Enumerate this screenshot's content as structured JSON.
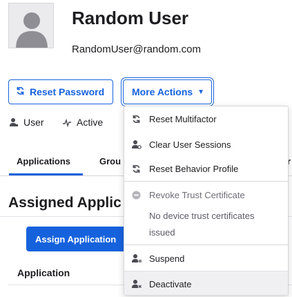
{
  "user": {
    "name": "Random User",
    "email": "RandomUser@random.com"
  },
  "actions": {
    "reset_password": "Reset Password",
    "more_actions": "More Actions"
  },
  "meta": {
    "type_label": "User",
    "status_label": "Active"
  },
  "tabs": [
    {
      "label": "Applications",
      "active": true
    },
    {
      "label": "Grou",
      "active": false
    },
    {
      "label": "r",
      "active": false
    }
  ],
  "section": {
    "title": "Assigned Applic",
    "assign_button": "Assign Application",
    "table_headers": [
      "Application"
    ]
  },
  "more_actions_menu": {
    "items": [
      {
        "label": "Reset Multifactor",
        "icon": "refresh-icon",
        "enabled": true
      },
      {
        "label": "Clear User Sessions",
        "icon": "user-clear-icon",
        "enabled": true
      },
      {
        "label": "Reset Behavior Profile",
        "icon": "refresh-icon",
        "enabled": true
      },
      {
        "label": "Revoke Trust Certificate",
        "icon": "minus-circle-icon",
        "enabled": false
      },
      {
        "label": "Suspend",
        "icon": "user-pause-icon",
        "enabled": true
      },
      {
        "label": "Deactivate",
        "icon": "user-remove-icon",
        "enabled": true,
        "hovered": true
      }
    ],
    "note": "No device trust certificates issued"
  },
  "colors": {
    "accent": "#1662dd",
    "text": "#1d1d21",
    "muted": "#6e6e78",
    "border": "#d7d7dc"
  }
}
